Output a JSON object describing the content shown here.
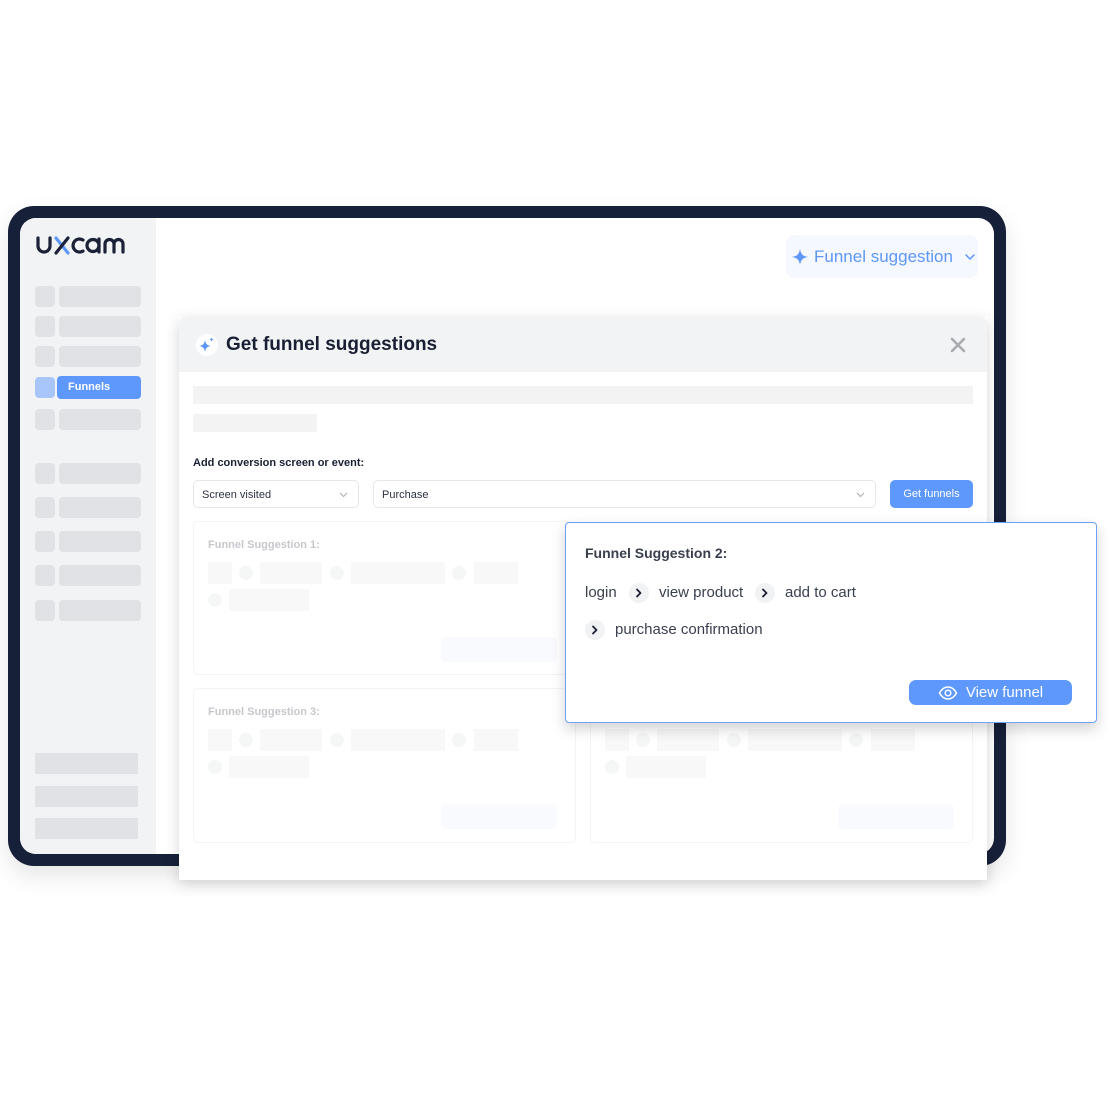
{
  "app": {
    "logo_text": "uxcam"
  },
  "sidebar": {
    "active_item": {
      "label": "Funnels"
    }
  },
  "header": {
    "funnel_suggestion_button": {
      "label": "Funnel suggestion",
      "icon": "sparkle-icon"
    }
  },
  "modal": {
    "title": "Get funnel suggestions",
    "icon": "sparkles-icon",
    "close_icon": "close-icon",
    "field_label": "Add conversion screen or event:",
    "type_select": {
      "value": "Screen visited"
    },
    "target_select": {
      "value": "Purchase"
    },
    "get_button": {
      "label": "Get funnels"
    },
    "cards": [
      {
        "title": "Funnel Suggestion 1:"
      },
      {
        "title": "Funnel Suggestion 3:"
      }
    ]
  },
  "focused_card": {
    "title": "Funnel Suggestion 2:",
    "steps": [
      "login",
      "view product",
      "add to cart",
      "purchase confirmation"
    ],
    "view_button": {
      "label": "View funnel",
      "icon": "eye-icon"
    }
  },
  "colors": {
    "brand_blue": "#5f98fd",
    "frame_navy": "#172039",
    "sidebar_bg": "#f2f3f5"
  }
}
